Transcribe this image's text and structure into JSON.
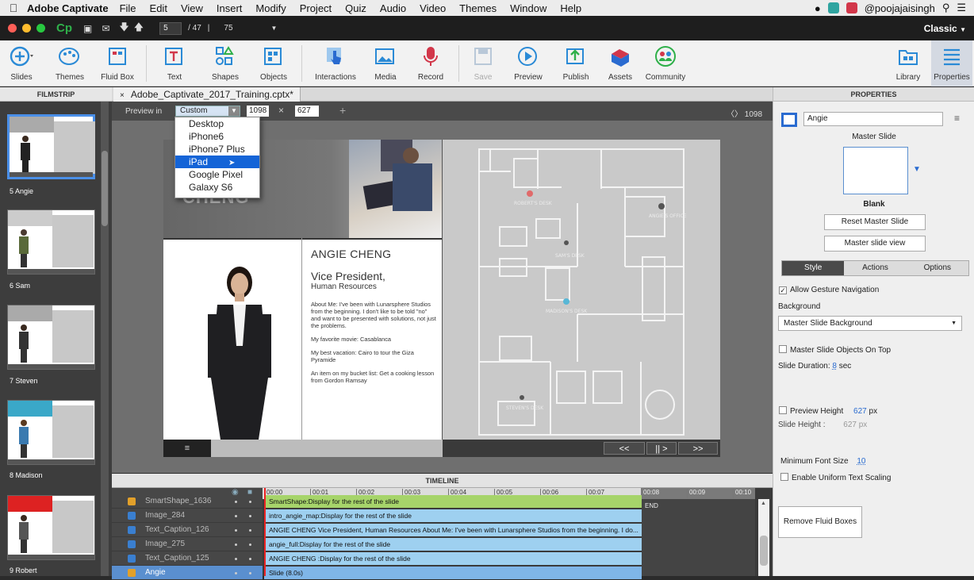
{
  "menubar": {
    "apple": "",
    "app": "Adobe Captivate",
    "items": [
      "File",
      "Edit",
      "View",
      "Insert",
      "Modify",
      "Project",
      "Quiz",
      "Audio",
      "Video",
      "Themes",
      "Window",
      "Help"
    ],
    "user": "@poojajaisingh"
  },
  "titlebar": {
    "logo": "Cp",
    "current_slide": "5",
    "total_slides": "/ 47",
    "separator": "|",
    "zoom": "75",
    "workspace": "Classic"
  },
  "toolbar": {
    "items": [
      {
        "label": "Slides",
        "icon": "plus-circle-icon"
      },
      {
        "label": "Themes",
        "icon": "palette-icon"
      },
      {
        "label": "Fluid Box",
        "icon": "fluid-box-icon"
      },
      {
        "label": "Text",
        "icon": "text-icon"
      },
      {
        "label": "Shapes",
        "icon": "shapes-icon"
      },
      {
        "label": "Objects",
        "icon": "objects-icon"
      },
      {
        "label": "Interactions",
        "icon": "hand-pointer-icon"
      },
      {
        "label": "Media",
        "icon": "image-icon"
      },
      {
        "label": "Record",
        "icon": "microphone-icon"
      },
      {
        "label": "Save",
        "icon": "floppy-icon"
      },
      {
        "label": "Preview",
        "icon": "play-icon"
      },
      {
        "label": "Publish",
        "icon": "publish-icon"
      },
      {
        "label": "Assets",
        "icon": "assets-icon"
      },
      {
        "label": "Community",
        "icon": "community-icon"
      },
      {
        "label": "Library",
        "icon": "folder-icon"
      },
      {
        "label": "Properties",
        "icon": "properties-icon"
      }
    ]
  },
  "filmstrip": {
    "header": "FILMSTRIP",
    "slides": [
      {
        "label": "5 Angie",
        "selected": true
      },
      {
        "label": "6 Sam"
      },
      {
        "label": "7 Steven"
      },
      {
        "label": "8 Madison"
      },
      {
        "label": "9 Robert"
      }
    ]
  },
  "document": {
    "tab_close": "×",
    "tab_title": "Adobe_Captivate_2017_Training.cptx*"
  },
  "preview_bar": {
    "label": "Preview in",
    "device": "Custom",
    "width": "1098",
    "height": "627",
    "times": "×",
    "plus": "+",
    "right_value": "1098"
  },
  "device_dropdown": {
    "options": [
      "Desktop",
      "iPhone6",
      "iPhone7 Plus",
      "iPad",
      "Google Pixel",
      "Galaxy S6"
    ],
    "highlighted": "iPad"
  },
  "slide": {
    "banner_ghost": "CHENG",
    "name": "ANGIE CHENG",
    "title": "Vice President,",
    "department": "Human Resources",
    "about": "About Me: I've been with Lunarsphere Studios from the beginning. I don't like to be told \"no\" and want to be presented with solutions, not just the problems.",
    "movie": "My favorite movie: Casablanca",
    "vacation": "My best vacation: Cairo to tour the Giza Pyramide",
    "bucket": "An item on my bucket list: Get a cooking lesson from Gordon Ramsay",
    "plan_labels": [
      "ROBERT'S DESK",
      "ANGIE'S OFFICE",
      "SAM'S DESK",
      "MADISON'S DESK",
      "STEVEN'S DESK"
    ],
    "nav_menu": "≡",
    "nav_prev": "<<",
    "nav_play": "|| >",
    "nav_next": ">>"
  },
  "timeline": {
    "header": "TIMELINE",
    "ticks": [
      "00:00",
      "00:01",
      "00:02",
      "00:03",
      "00:04",
      "00:05",
      "00:06",
      "00:07",
      "00:08",
      "00:09",
      "00:10"
    ],
    "end_label": "END",
    "rows": [
      {
        "name": "SmartShape_1636",
        "bar": "SmartShape:Display for the rest of the slide",
        "color": "#a6d46a",
        "icon_color": "#e2a02a"
      },
      {
        "name": "Image_284",
        "bar": "intro_angie_map:Display for the rest of the slide",
        "color": "#9ed0f0",
        "icon_color": "#3a7fd0"
      },
      {
        "name": "Text_Caption_126",
        "bar": "ANGIE CHENG  Vice President, Human Resources  About Me: I've been with Lunarsphere Studios from the beginning. I do...",
        "color": "#9ed0f0",
        "icon_color": "#3a7fd0"
      },
      {
        "name": "Image_275",
        "bar": "angie_full:Display for the rest of the slide",
        "color": "#9ed0f0",
        "icon_color": "#3a7fd0"
      },
      {
        "name": "Text_Caption_125",
        "bar": "ANGIE  CHENG :Display for the rest of the slide",
        "color": "#9ed0f0",
        "icon_color": "#3a7fd0"
      },
      {
        "name": "Angie",
        "bar": "Slide (8.0s)",
        "color": "#7fb6e8",
        "icon_color": "#e2a02a",
        "selected": true
      }
    ]
  },
  "properties": {
    "header": "PROPERTIES",
    "slide_name": "Angie",
    "master_slide_label": "Master Slide",
    "master_slide_name": "Blank",
    "reset_button": "Reset Master Slide",
    "view_button": "Master slide view",
    "tabs": [
      "Style",
      "Actions",
      "Options"
    ],
    "active_tab": "Style",
    "allow_gesture": "Allow Gesture Navigation",
    "background_label": "Background",
    "background_value": "Master Slide Background",
    "objects_on_top": "Master Slide Objects On Top",
    "duration_label": "Slide Duration:",
    "duration_value": "8",
    "duration_unit": "sec",
    "preview_height_label": "Preview Height",
    "preview_height_value": "627",
    "px": "px",
    "slide_height_label": "Slide Height :",
    "slide_height_value": "627",
    "min_font_label": "Minimum Font Size",
    "min_font_value": "10",
    "uniform_scaling": "Enable Uniform Text Scaling",
    "remove_fluid": "Remove Fluid Boxes"
  }
}
